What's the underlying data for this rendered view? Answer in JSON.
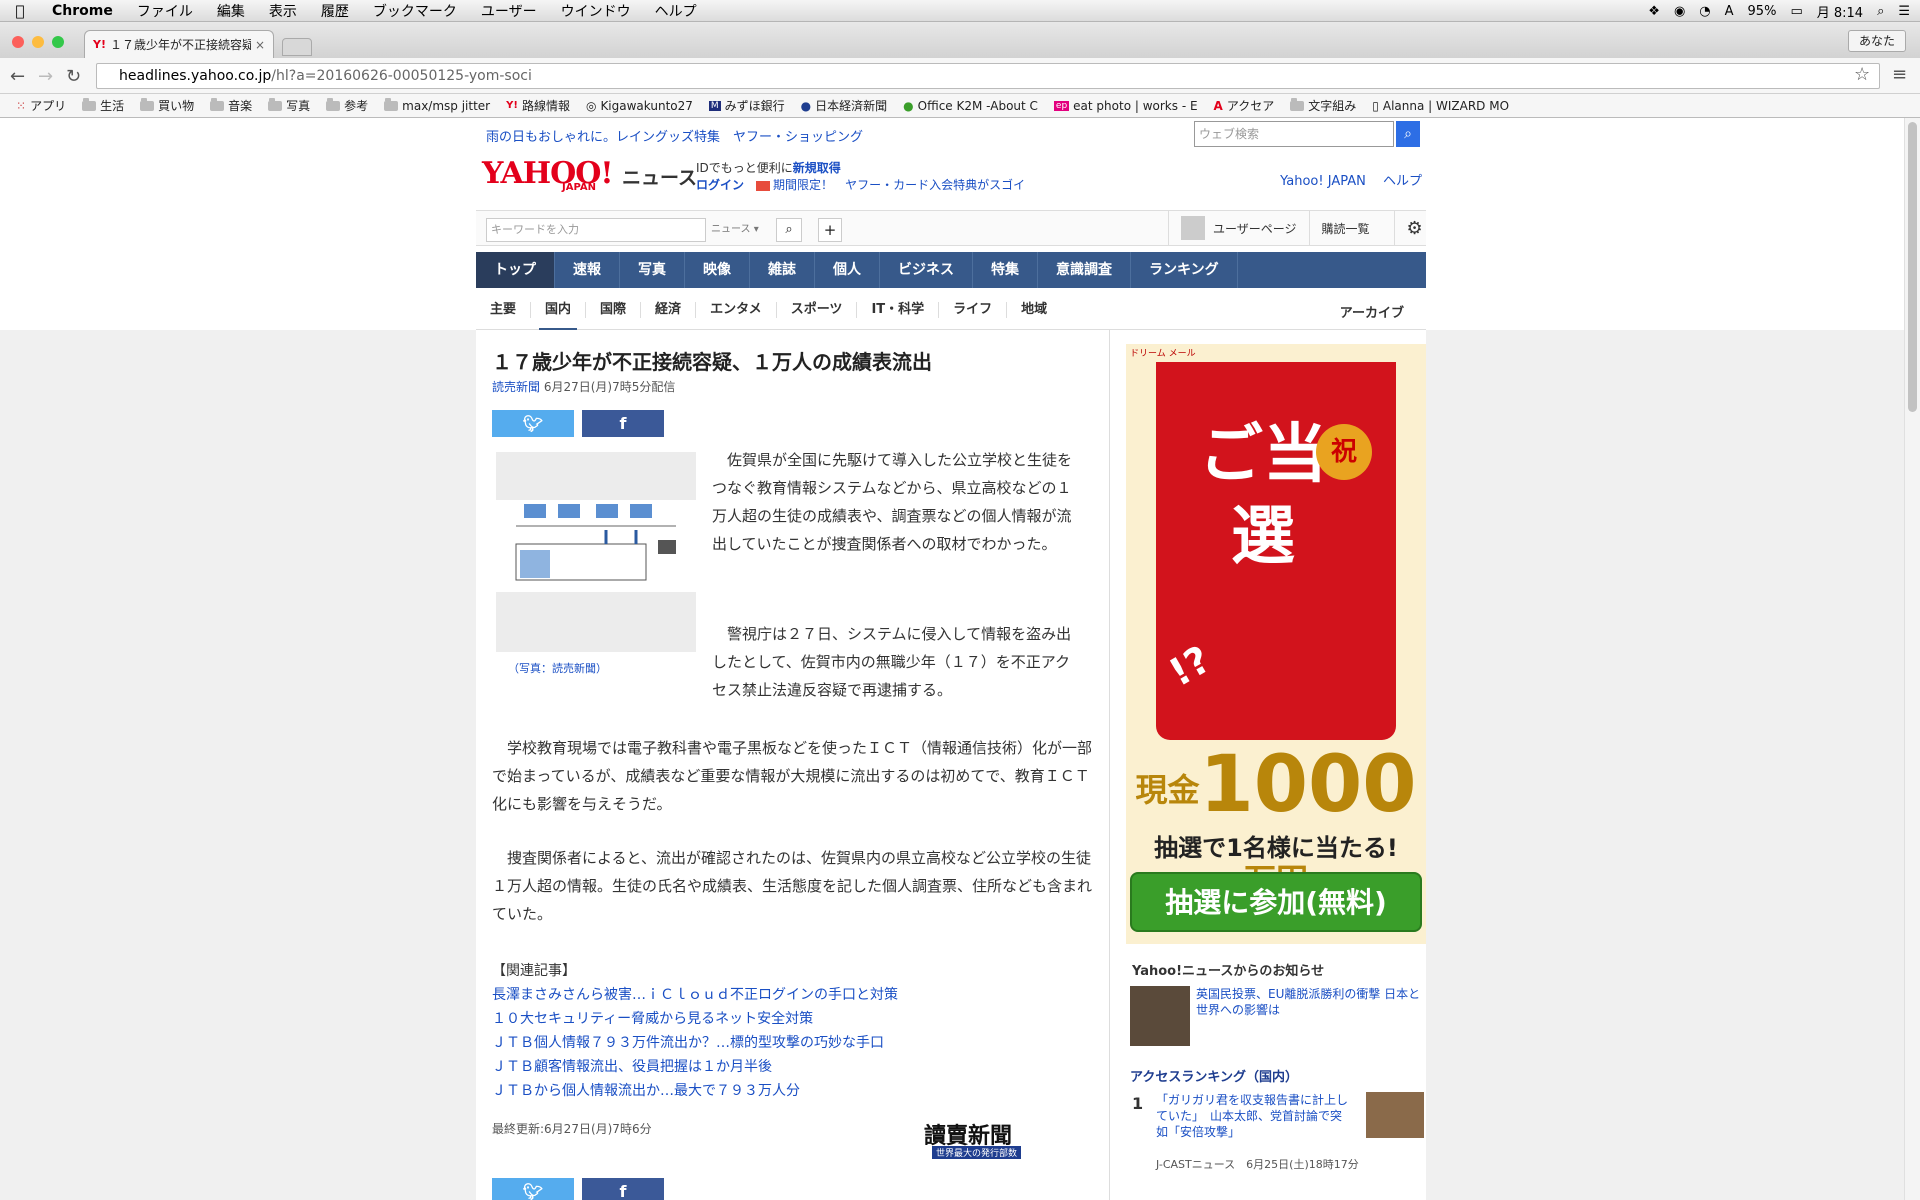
{
  "menubar": {
    "app": "Chrome",
    "items": [
      "ファイル",
      "編集",
      "表示",
      "履歴",
      "ブックマーク",
      "ユーザー",
      "ウインドウ",
      "ヘルプ"
    ],
    "battery": "95%",
    "clock": "月 8:14"
  },
  "browser": {
    "tab_title": "１７歳少年が不正接続容疑...",
    "profile": "あなた",
    "url_host": "headlines.yahoo.co.jp",
    "url_path": "/hl?a=20160626-00050125-yom-soci",
    "bookmarks": [
      "アプリ",
      "生活",
      "買い物",
      "音楽",
      "写真",
      "参考",
      "max/msp jitter",
      "路線情報",
      "Kigawakunto27",
      "みずほ銀行",
      "日本経済新聞",
      "Office K2M -About C",
      "eat photo | works - E",
      "アクセア",
      "文字組み",
      "Alanna | WIZARD MO"
    ]
  },
  "header": {
    "promo": "雨の日もおしゃれに。レイングッズ特集　ヤフー・ショッピング",
    "websearch_placeholder": "ウェブ検索",
    "logo": "YAHOO!",
    "logo_sub": "JAPAN",
    "logo_news": "ニュース",
    "id_line1": "IDでもっと便利に",
    "id_signup": "新規取得",
    "id_login": "ログイン",
    "id_limited": "期間限定！",
    "id_card": "ヤフー・カード入会特典がスゴイ",
    "links": [
      "Yahoo! JAPAN",
      "ヘルプ"
    ]
  },
  "searchbar": {
    "placeholder": "キーワードを入力",
    "category": "ニュース",
    "user_page": "ユーザーページ",
    "subscriptions": "購読一覧"
  },
  "mainnav": [
    "トップ",
    "速報",
    "写真",
    "映像",
    "雑誌",
    "個人",
    "ビジネス",
    "特集",
    "意識調査",
    "ランキング"
  ],
  "subnav": [
    "主要",
    "国内",
    "国際",
    "経済",
    "エンタメ",
    "スポーツ",
    "IT・科学",
    "ライフ",
    "地域"
  ],
  "archive": "アーカイブ",
  "article": {
    "headline": "１７歳少年が不正接続容疑、１万人の成績表流出",
    "source": "読売新聞",
    "date": "6月27日(月)7時5分配信",
    "caption": "（写真：読売新聞）",
    "paragraphs": [
      "　佐賀県が全国に先駆けて導入した公立学校と生徒をつなぐ教育情報システムなどから、県立高校などの１万人超の生徒の成績表や、調査票などの個人情報が流出していたことが捜査関係者への取材でわかった。",
      "　警視庁は２７日、システムに侵入して情報を盗み出したとして、佐賀市内の無職少年（１７）を不正アクセス禁止法違反容疑で再逮捕する。",
      "　学校教育現場では電子教科書や電子黒板などを使ったＩＣＴ（情報通信技術）化が一部で始まっているが、成績表など重要な情報が大規模に流出するのは初めてで、教育ＩＣＴ化にも影響を与えそうだ。",
      "　捜査関係者によると、流出が確認されたのは、佐賀県内の県立高校など公立学校の生徒１万人超の情報。生徒の氏名や成績表、生活態度を記した個人調査票、住所なども含まれていた。"
    ],
    "related_title": "【関連記事】",
    "related": [
      "長澤まさみさんら被害…ｉＣｌｏｕｄ不正ログインの手口と対策",
      "１０大セキュリティー脅威から見るネット安全対策",
      "ＪＴＢ個人情報７９３万件流出か？…標的型攻撃の巧妙な手口",
      "ＪＴＢ顧客情報流出、役員把握は１か月半後",
      "ＪＴＢから個人情報流出か…最大で７９３万人分"
    ],
    "updated": "最終更新:6月27日(月)7時6分",
    "publisher_logo": "讀賣新聞",
    "publisher_tagline": "世界最大の発行部数"
  },
  "ad": {
    "top": "ドリーム メール",
    "main": "ご当選",
    "badge": "祝",
    "exclaim": "!?",
    "amount_prefix": "現金",
    "amount": "1000",
    "amount_suffix": "万円",
    "sub": "抽選で1名様に当たる!",
    "cta": "抽選に参加(無料)"
  },
  "sidebar": {
    "notice_title": "Yahoo!ニュースからのお知らせ",
    "notice_text": "英国民投票、EU離脱派勝利の衝撃 日本と世界への影響は",
    "ranking_title": "アクセスランキング（国内）",
    "rank1_num": "1",
    "rank1_text": "「ガリガリ君を収支報告書に計上していた」　山本太郎、党首討論で突如「安倍攻撃」",
    "rank1_meta": "J-CASTニュース　6月25日(土)18時17分"
  },
  "colors": {
    "nav_blue": "#37598a",
    "link_blue": "#1a4fc4",
    "yahoo_red": "#e3001b",
    "twitter": "#55acee",
    "facebook": "#3b5998"
  }
}
